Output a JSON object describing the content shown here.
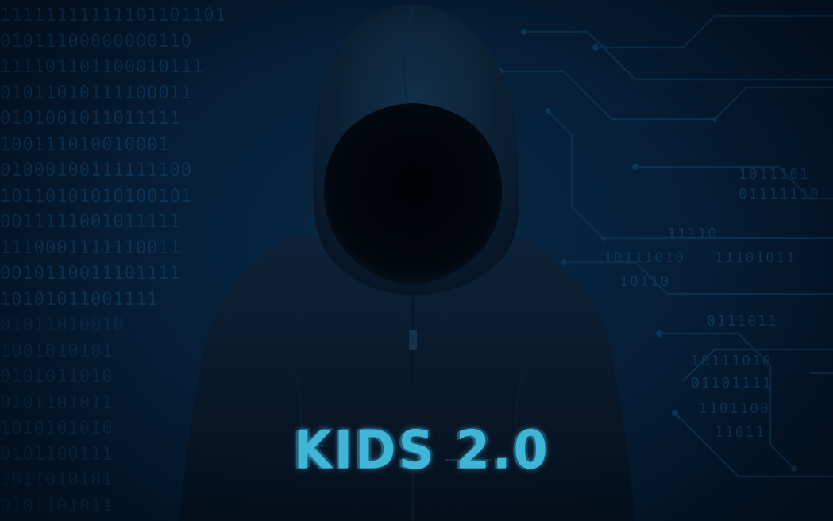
{
  "title": "KIDS 2.0",
  "colors": {
    "background": "#031528",
    "binary_text": "#0f3556",
    "hoodie": "#0b1d30",
    "face_void": "#01050a",
    "title_text": "#3fb6d8"
  },
  "binary_rows": [
    "11111111111101101101",
    "01011100000000110",
    "111101101100010111",
    "01011010111100011",
    "0101001011011111",
    "100111010010001",
    "01000100111111100",
    "10110101010100101",
    "0011111001011111",
    "1110001111110011",
    "0010110011101111",
    "10101011001111",
    "01011010010",
    "1001010101",
    "0101011010",
    "0101101011",
    "1010101010",
    "0101100111",
    "1011010101",
    "0101101011"
  ],
  "circuit_rows": [
    "11110",
    "1011101",
    "01111110",
    "10111010",
    "11101011",
    "10110",
    "0111011",
    "10111010",
    "01101111",
    "1101100",
    "11011"
  ]
}
